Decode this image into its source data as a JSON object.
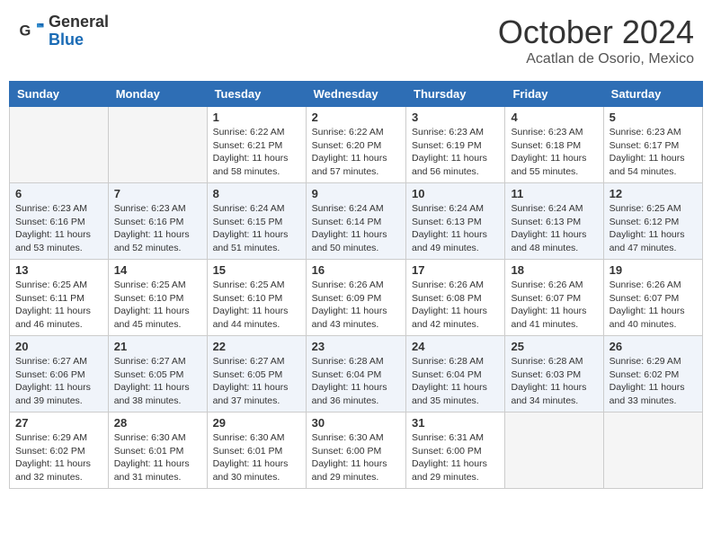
{
  "header": {
    "logo_general": "General",
    "logo_blue": "Blue",
    "month_title": "October 2024",
    "location": "Acatlan de Osorio, Mexico"
  },
  "days_of_week": [
    "Sunday",
    "Monday",
    "Tuesday",
    "Wednesday",
    "Thursday",
    "Friday",
    "Saturday"
  ],
  "weeks": [
    [
      {
        "day": "",
        "empty": true
      },
      {
        "day": "",
        "empty": true
      },
      {
        "day": "1",
        "sunrise": "6:22 AM",
        "sunset": "6:21 PM",
        "daylight": "11 hours and 58 minutes."
      },
      {
        "day": "2",
        "sunrise": "6:22 AM",
        "sunset": "6:20 PM",
        "daylight": "11 hours and 57 minutes."
      },
      {
        "day": "3",
        "sunrise": "6:23 AM",
        "sunset": "6:19 PM",
        "daylight": "11 hours and 56 minutes."
      },
      {
        "day": "4",
        "sunrise": "6:23 AM",
        "sunset": "6:18 PM",
        "daylight": "11 hours and 55 minutes."
      },
      {
        "day": "5",
        "sunrise": "6:23 AM",
        "sunset": "6:17 PM",
        "daylight": "11 hours and 54 minutes."
      }
    ],
    [
      {
        "day": "6",
        "sunrise": "6:23 AM",
        "sunset": "6:16 PM",
        "daylight": "11 hours and 53 minutes."
      },
      {
        "day": "7",
        "sunrise": "6:23 AM",
        "sunset": "6:16 PM",
        "daylight": "11 hours and 52 minutes."
      },
      {
        "day": "8",
        "sunrise": "6:24 AM",
        "sunset": "6:15 PM",
        "daylight": "11 hours and 51 minutes."
      },
      {
        "day": "9",
        "sunrise": "6:24 AM",
        "sunset": "6:14 PM",
        "daylight": "11 hours and 50 minutes."
      },
      {
        "day": "10",
        "sunrise": "6:24 AM",
        "sunset": "6:13 PM",
        "daylight": "11 hours and 49 minutes."
      },
      {
        "day": "11",
        "sunrise": "6:24 AM",
        "sunset": "6:13 PM",
        "daylight": "11 hours and 48 minutes."
      },
      {
        "day": "12",
        "sunrise": "6:25 AM",
        "sunset": "6:12 PM",
        "daylight": "11 hours and 47 minutes."
      }
    ],
    [
      {
        "day": "13",
        "sunrise": "6:25 AM",
        "sunset": "6:11 PM",
        "daylight": "11 hours and 46 minutes."
      },
      {
        "day": "14",
        "sunrise": "6:25 AM",
        "sunset": "6:10 PM",
        "daylight": "11 hours and 45 minutes."
      },
      {
        "day": "15",
        "sunrise": "6:25 AM",
        "sunset": "6:10 PM",
        "daylight": "11 hours and 44 minutes."
      },
      {
        "day": "16",
        "sunrise": "6:26 AM",
        "sunset": "6:09 PM",
        "daylight": "11 hours and 43 minutes."
      },
      {
        "day": "17",
        "sunrise": "6:26 AM",
        "sunset": "6:08 PM",
        "daylight": "11 hours and 42 minutes."
      },
      {
        "day": "18",
        "sunrise": "6:26 AM",
        "sunset": "6:07 PM",
        "daylight": "11 hours and 41 minutes."
      },
      {
        "day": "19",
        "sunrise": "6:26 AM",
        "sunset": "6:07 PM",
        "daylight": "11 hours and 40 minutes."
      }
    ],
    [
      {
        "day": "20",
        "sunrise": "6:27 AM",
        "sunset": "6:06 PM",
        "daylight": "11 hours and 39 minutes."
      },
      {
        "day": "21",
        "sunrise": "6:27 AM",
        "sunset": "6:05 PM",
        "daylight": "11 hours and 38 minutes."
      },
      {
        "day": "22",
        "sunrise": "6:27 AM",
        "sunset": "6:05 PM",
        "daylight": "11 hours and 37 minutes."
      },
      {
        "day": "23",
        "sunrise": "6:28 AM",
        "sunset": "6:04 PM",
        "daylight": "11 hours and 36 minutes."
      },
      {
        "day": "24",
        "sunrise": "6:28 AM",
        "sunset": "6:04 PM",
        "daylight": "11 hours and 35 minutes."
      },
      {
        "day": "25",
        "sunrise": "6:28 AM",
        "sunset": "6:03 PM",
        "daylight": "11 hours and 34 minutes."
      },
      {
        "day": "26",
        "sunrise": "6:29 AM",
        "sunset": "6:02 PM",
        "daylight": "11 hours and 33 minutes."
      }
    ],
    [
      {
        "day": "27",
        "sunrise": "6:29 AM",
        "sunset": "6:02 PM",
        "daylight": "11 hours and 32 minutes."
      },
      {
        "day": "28",
        "sunrise": "6:30 AM",
        "sunset": "6:01 PM",
        "daylight": "11 hours and 31 minutes."
      },
      {
        "day": "29",
        "sunrise": "6:30 AM",
        "sunset": "6:01 PM",
        "daylight": "11 hours and 30 minutes."
      },
      {
        "day": "30",
        "sunrise": "6:30 AM",
        "sunset": "6:00 PM",
        "daylight": "11 hours and 29 minutes."
      },
      {
        "day": "31",
        "sunrise": "6:31 AM",
        "sunset": "6:00 PM",
        "daylight": "11 hours and 29 minutes."
      },
      {
        "day": "",
        "empty": true
      },
      {
        "day": "",
        "empty": true
      }
    ]
  ],
  "labels": {
    "sunrise": "Sunrise:",
    "sunset": "Sunset:",
    "daylight": "Daylight:"
  }
}
